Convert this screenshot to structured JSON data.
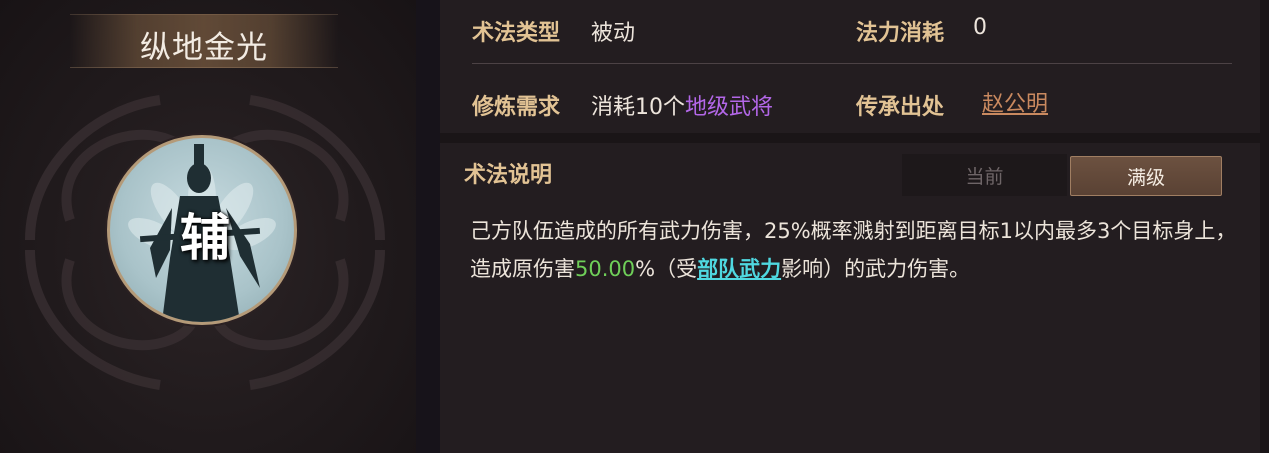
{
  "skill": {
    "name": "纵地金光",
    "role_char": "辅"
  },
  "info": {
    "type_label": "术法类型",
    "type_value": "被动",
    "mana_label": "法力消耗",
    "mana_value": "0",
    "train_label": "修炼需求",
    "train_value_prefix": "消耗10个",
    "train_value_highlight": "地级武将",
    "origin_label": "传承出处",
    "origin_value": "赵公明"
  },
  "description": {
    "title": "术法说明",
    "tabs": [
      {
        "label": "当前",
        "active": false
      },
      {
        "label": "满级",
        "active": true
      }
    ],
    "text_part1": "己方队伍造成的所有武力伤害，25%概率溅射到距离目标1以内最多3个目标身上，造成原伤害",
    "text_percent": "50.00",
    "text_part2": "%（受",
    "text_link": "部队武力",
    "text_part3": "影响）的武力伤害。"
  },
  "colors": {
    "label_gold": "#e2c394",
    "highlight_purple": "#b367e8",
    "value_green": "#6fcf59",
    "link_cyan": "#4fd8e0",
    "origin_link": "#c9895f"
  },
  "icons": [
    "swirl-ornament-icon",
    "general-silhouette-icon"
  ]
}
